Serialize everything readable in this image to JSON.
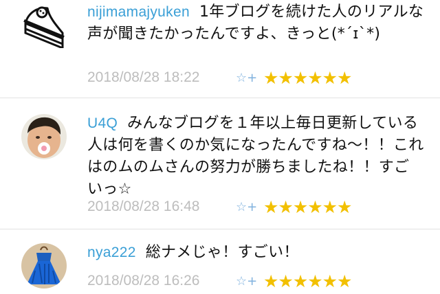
{
  "comments": [
    {
      "username": "nijimamajyuken",
      "text": "1年ブログを続けた人のリアルな声が聞きたかったんですよ、きっと(*´ɪ`*)",
      "date": "2018/08/28 18:22",
      "star_add_icon": "☆+",
      "stars": "★★★★★★",
      "avatar_icon": "cake-icon"
    },
    {
      "username": "U4Q",
      "text": "みんなブログを１年以上毎日更新している人は何を書くのか気になったんですね〜！！これはのムのムさんの努力が勝ちましたね！！すごいっ☆",
      "date": "2018/08/28 16:48",
      "star_add_icon": "☆+",
      "stars": "★★★★★★",
      "avatar_icon": "child-photo-icon"
    },
    {
      "username": "nya222",
      "text": "総ナメじゃ！すごい！",
      "date": "2018/08/28 16:26",
      "star_add_icon": "☆+",
      "stars": "★★★★★★",
      "avatar_icon": "blue-dress-photo-icon"
    }
  ]
}
